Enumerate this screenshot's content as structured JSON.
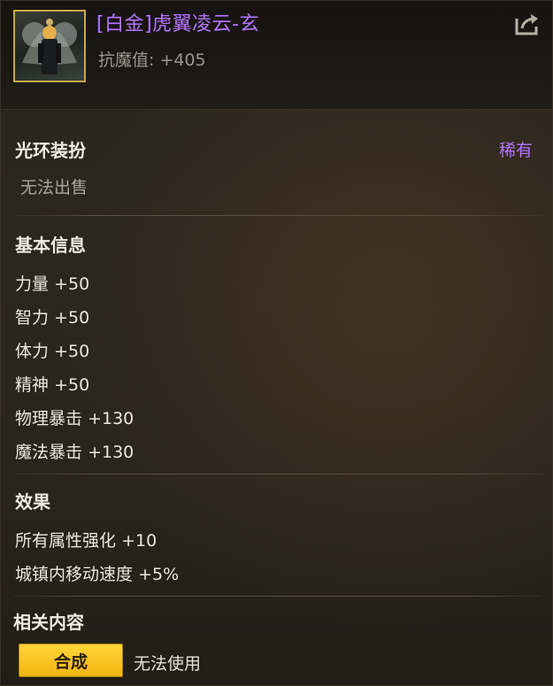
{
  "item": {
    "name": "[白金]虎翼凌云-玄",
    "resistance_label": "抗魔值:",
    "resistance_value": "+405",
    "icon": "dark-winged-character-portrait"
  },
  "category": {
    "type": "光环装扮",
    "rarity": "稀有",
    "sell_status": "无法出售"
  },
  "basic_info": {
    "title": "基本信息",
    "stats": [
      {
        "name": "力量",
        "value": "+50"
      },
      {
        "name": "智力",
        "value": "+50"
      },
      {
        "name": "体力",
        "value": "+50"
      },
      {
        "name": "精神",
        "value": "+50"
      },
      {
        "name": "物理暴击",
        "value": "+130"
      },
      {
        "name": "魔法暴击",
        "value": "+130"
      }
    ]
  },
  "effects": {
    "title": "效果",
    "lines": [
      {
        "name": "所有属性强化",
        "value": "+10"
      },
      {
        "name": "城镇内移动速度",
        "value": "+5%"
      }
    ]
  },
  "related": {
    "title": "相关内容",
    "synth_button": "合成",
    "use_status": "无法使用"
  },
  "colors": {
    "item_name": "#b574ff",
    "rarity": "#b574ff",
    "button": "#ffd43a"
  }
}
